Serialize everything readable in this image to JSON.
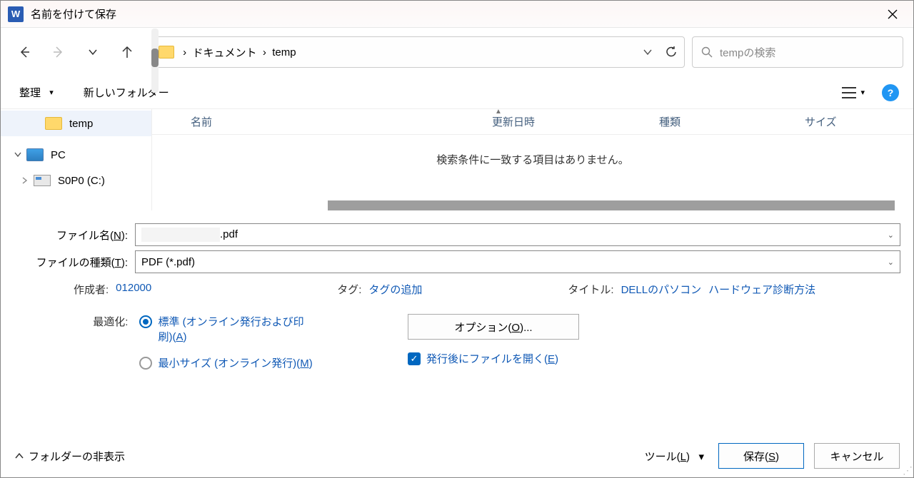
{
  "title": "名前を付けて保存",
  "breadcrumb": {
    "part1": "ドキュメント",
    "part2": "temp"
  },
  "search": {
    "placeholder": "tempの検索"
  },
  "toolbar": {
    "organize": "整理",
    "new_folder": "新しいフォルダー"
  },
  "tree": {
    "temp": "temp",
    "pc": "PC",
    "drive": "S0P0 (C:)"
  },
  "file_list": {
    "columns": {
      "name": "名前",
      "date": "更新日時",
      "type": "種類",
      "size": "サイズ"
    },
    "empty_message": "検索条件に一致する項目はありません。"
  },
  "fields": {
    "filename_label": "ファイル名(N):",
    "filename_value": ".pdf",
    "filetype_label": "ファイルの種類(T):",
    "filetype_value": "PDF (*.pdf)"
  },
  "meta": {
    "author_label": "作成者:",
    "author_value": "012000",
    "tag_label": "タグ:",
    "tag_value": "タグの追加",
    "title_label": "タイトル:",
    "title_value1": "DELLのパソコン",
    "title_value2": "ハードウェア診断方法"
  },
  "optimize": {
    "label": "最適化:",
    "option_standard": "標準 (オンライン発行および印刷)(A)",
    "option_min": "最小サイズ (オンライン発行)(M)",
    "options_button": "オプション(O)...",
    "open_after": "発行後にファイルを開く(E)"
  },
  "bottom": {
    "folder_hide": "フォルダーの非表示",
    "tools": "ツール(L)",
    "save": "保存(S)",
    "cancel": "キャンセル"
  }
}
